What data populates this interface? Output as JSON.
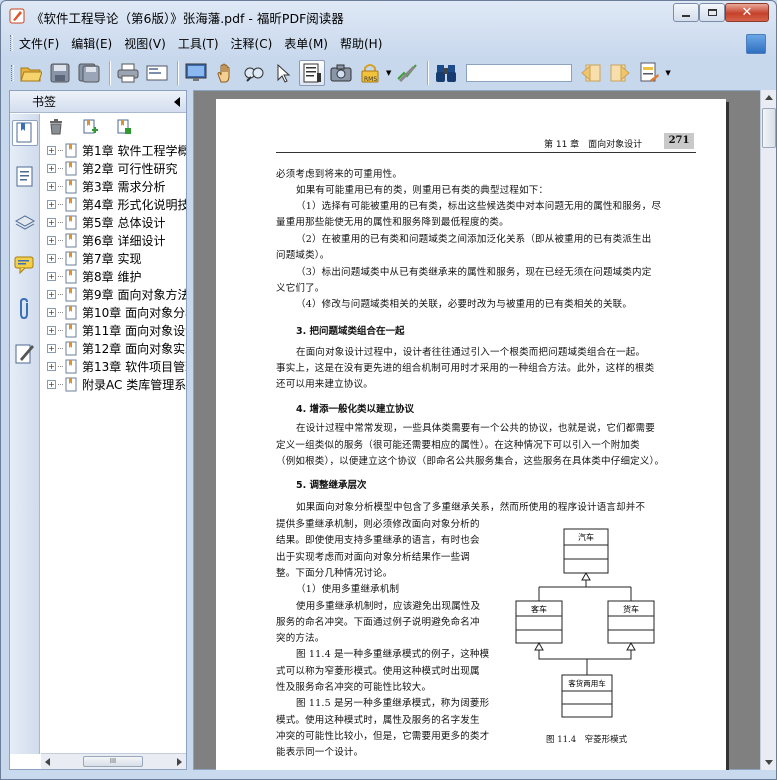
{
  "window": {
    "title": "《软件工程导论（第6版）》张海藩.pdf - 福昕PDF阅读器",
    "controls": [
      "minimize-icon",
      "maximize-icon",
      "close-icon"
    ]
  },
  "menu": [
    "文件(F)",
    "编辑(E)",
    "视图(V)",
    "工具(T)",
    "注释(C)",
    "表单(M)",
    "帮助(H)"
  ],
  "toolbar": {
    "icons": [
      "open-folder-icon",
      "save-icon",
      "save-as-icon",
      "print-icon",
      "email-icon",
      "fullscreen-icon",
      "hand-tool-icon",
      "snapshot-zoom-icon",
      "select-arrow-icon",
      "select-text-icon",
      "camera-icon",
      "rms-lock-icon",
      "sign-icon",
      "search-binoculars-icon",
      "prev-result-icon",
      "next-result-icon",
      "highlight-icon"
    ],
    "search_value": ""
  },
  "sidebar": {
    "title": "书签",
    "scroll_label": "III",
    "bookmarks": [
      "第1章 软件工程学概",
      "第2章 可行性研究",
      "第3章 需求分析",
      "第4章 形式化说明技",
      "第5章 总体设计",
      "第6章 详细设计",
      "第7章 实现",
      "第8章 维护",
      "第9章 面向对象方法",
      "第10章 面向对象分析",
      "第11章 面向对象设计",
      "第12章 面向对象实现",
      "第13章 软件项目管理",
      "附录AC 类库管理系统"
    ]
  },
  "page": {
    "header_chapter": "第 11 章　面向对象设计",
    "page_number": "271",
    "lines": [
      "必须考虑到将来的可重用性。",
      "如果有可能重用已有的类，则重用已有类的典型过程如下：",
      "（1）选择有可能被重用的已有类，标出这些候选类中对本问题无用的属性和服务，尽",
      "量重用那些能使无用的属性和服务降到最低程度的类。",
      "（2）在被重用的已有类和问题域类之间添加泛化关系（即从被重用的已有类派生出",
      "问题域类）。",
      "（3）标出问题域类中从已有类继承来的属性和服务，现在已经无须在问题域类内定",
      "义它们了。",
      "（4）修改与问题域类相关的关联，必要时改为与被重用的已有类相关的关联。"
    ],
    "heading3": "3. 把问题域类组合在一起",
    "para3": [
      "在面向对象设计过程中，设计者往往通过引入一个根类而把问题域类组合在一起。",
      "事实上，这是在没有更先进的组合机制可用时才采用的一种组合方法。此外，这样的根类",
      "还可以用来建立协议。"
    ],
    "heading4": "4. 增添一般化类以建立协议",
    "para4": [
      "在设计过程中常常发现，一些具体类需要有一个公共的协议，也就是说，它们都需要",
      "定义一组类似的服务（很可能还需要相应的属性）。在这种情况下可以引入一个附加类",
      "（例如根类），以便建立这个协议（即命名公共服务集合，这些服务在具体类中仔细定义）。"
    ],
    "heading5": "5. 调整继承层次",
    "para5_full": "如果面向对象分析模型中包含了多重继承关系，然而所使用的程序设计语言却并不",
    "para5": [
      "提供多重继承机制，则必须修改面向对象分析的",
      "结果。即使使用支持多重继承的语言，有时也会",
      "出于实现考虑而对面向对象分析结果作一些调",
      "整。下面分几种情况讨论。",
      "（1）使用多重继承机制",
      "使用多重继承机制时，应该避免出现属性及",
      "服务的命名冲突。下面通过例子说明避免命名冲",
      "突的方法。",
      "图 11.4 是一种多重继承模式的例子，这种模",
      "式可以称为窄菱形模式。使用这种模式时出现属",
      "性及服务命名冲突的可能性比较大。",
      "图 11.5 是另一种多重继承模式，称为阔菱形",
      "模式。使用这种模式时，属性及服务的名字发生",
      "冲突的可能性比较小，但是，它需要用更多的类才",
      "能表示同一个设计。"
    ],
    "diagram": {
      "top": "汽车",
      "left": "客车",
      "right": "货车",
      "bottom": "客货两用车",
      "caption": "图 11.4　窄菱形模式"
    }
  }
}
